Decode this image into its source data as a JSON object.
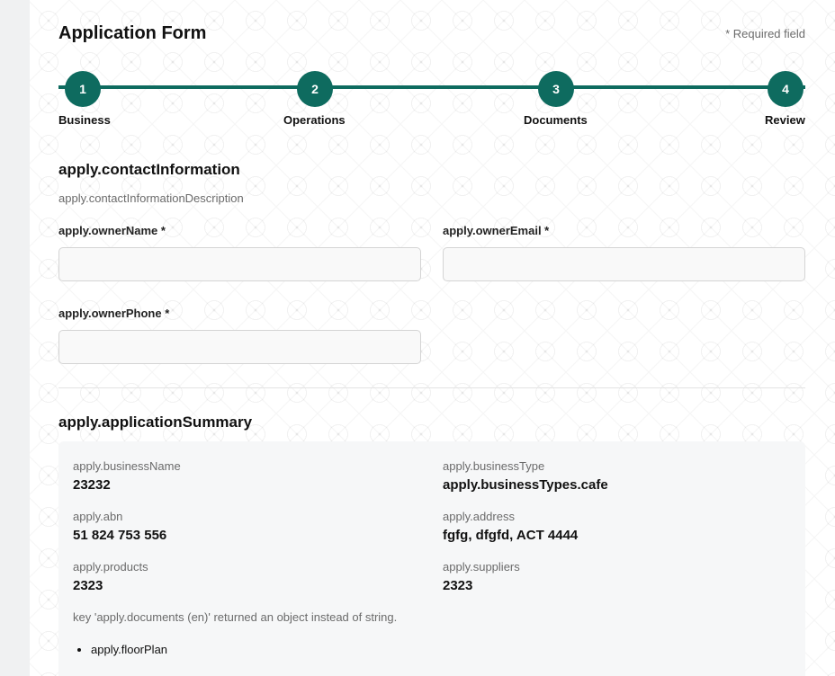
{
  "header": {
    "title": "Application Form",
    "required_note": "* Required field"
  },
  "stepper": {
    "steps": [
      {
        "number": "1",
        "label": "Business"
      },
      {
        "number": "2",
        "label": "Operations"
      },
      {
        "number": "3",
        "label": "Documents"
      },
      {
        "number": "4",
        "label": "Review"
      }
    ],
    "accent_color": "#0e6b5f"
  },
  "contact": {
    "title": "apply.contactInformation",
    "description": "apply.contactInformationDescription",
    "owner_name_label": "apply.ownerName *",
    "owner_name_value": "",
    "owner_email_label": "apply.ownerEmail *",
    "owner_email_value": "",
    "owner_phone_label": "apply.ownerPhone *",
    "owner_phone_value": ""
  },
  "summary": {
    "title": "apply.applicationSummary",
    "items": [
      {
        "label": "apply.businessName",
        "value": "23232"
      },
      {
        "label": "apply.businessType",
        "value": "apply.businessTypes.cafe"
      },
      {
        "label": "apply.abn",
        "value": "51 824 753 556"
      },
      {
        "label": "apply.address",
        "value": "fgfg, dfgfd, ACT 4444"
      },
      {
        "label": "apply.products",
        "value": "2323"
      },
      {
        "label": "apply.suppliers",
        "value": "2323"
      }
    ],
    "documents_error": "key 'apply.documents (en)' returned an object instead of string.",
    "documents": [
      "apply.floorPlan"
    ]
  }
}
